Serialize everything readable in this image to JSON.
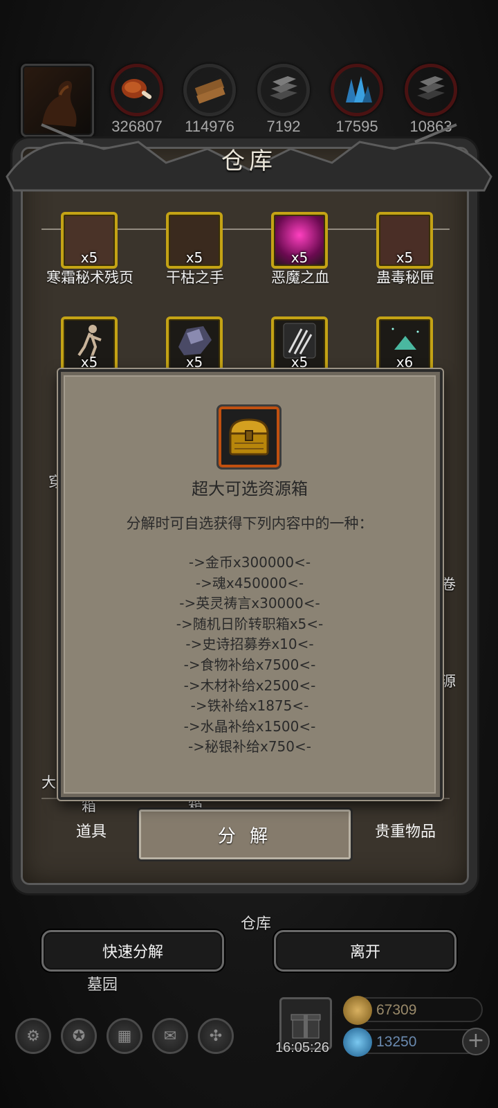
{
  "resources": [
    {
      "icon": "meat-icon",
      "value": "326807"
    },
    {
      "icon": "wood-icon",
      "value": "114976"
    },
    {
      "icon": "iron-icon",
      "value": "7192"
    },
    {
      "icon": "crystal-icon",
      "value": "17595"
    },
    {
      "icon": "mithril-icon",
      "value": "10863"
    }
  ],
  "warehouse": {
    "title": "仓库",
    "row1": [
      {
        "label": "寒霜秘术残页",
        "count": "x5"
      },
      {
        "label": "干枯之手",
        "count": "x5"
      },
      {
        "label": "恶魔之血",
        "count": "x5"
      },
      {
        "label": "蛊毒秘匣",
        "count": "x5"
      }
    ],
    "row2": [
      {
        "count": "x5",
        "icon": "doll-icon"
      },
      {
        "count": "x5",
        "icon": "ore-icon"
      },
      {
        "count": "x5",
        "icon": "scroll-icon"
      },
      {
        "count": "x6",
        "icon": "gem-icon"
      }
    ],
    "partial_labels": {
      "left_1": "穿",
      "right_1": "卷",
      "right_2": "源",
      "left_2": "大",
      "bottom_1": "箱",
      "bottom_2": "箱"
    }
  },
  "tabs": {
    "items": "道具",
    "decompose": "分 解",
    "valuables": "贵重物品"
  },
  "modal": {
    "title": "超大可选资源箱",
    "description": "分解时可自选获得下列内容中的一种：",
    "options": [
      "->金币x300000<-",
      "->魂x450000<-",
      "->英灵祷言x30000<-",
      "->随机日阶转职箱x5<-",
      "->史诗招募券x10<-",
      "->食物补给x7500<-",
      "->木材补给x2500<-",
      "->铁补给x1875<-",
      "->水晶补给x1500<-",
      "->秘银补给x750<-"
    ]
  },
  "bottom": {
    "location_warehouse": "仓库",
    "location_cemetery": "墓园",
    "quick_decompose": "快速分解",
    "leave": "离开",
    "timer": "16:05:26",
    "gold": "67309",
    "gems": "13250",
    "plus": "+"
  },
  "colors": {
    "frame_gold": "#c4a315",
    "modal_bg": "#8b8374",
    "panel_bg": "#3a342c"
  }
}
